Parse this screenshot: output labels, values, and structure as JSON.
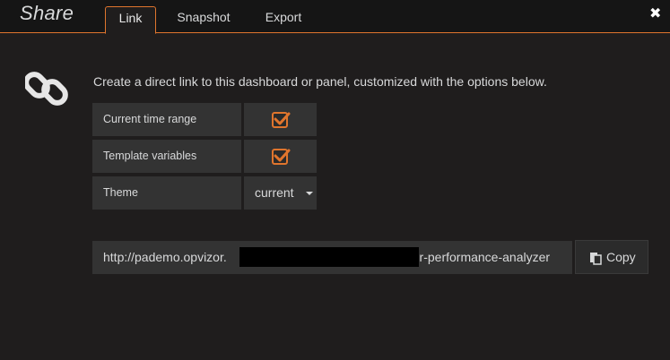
{
  "header": {
    "title": "Share",
    "tabs": [
      {
        "label": "Link",
        "active": true
      },
      {
        "label": "Snapshot",
        "active": false
      },
      {
        "label": "Export",
        "active": false
      }
    ],
    "close_glyph": "✖",
    "accent_color": "#e0752d"
  },
  "main": {
    "icon": "link-icon",
    "description": "Create a direct link to this dashboard or panel, customized with the options below.",
    "options": [
      {
        "label": "Current time range",
        "type": "checkbox",
        "checked": true
      },
      {
        "label": "Template variables",
        "type": "checkbox",
        "checked": true
      },
      {
        "label": "Theme",
        "type": "select",
        "value": "current"
      }
    ],
    "url": {
      "prefix": "http://pademo.opvizor.",
      "suffix": "zor-performance-analyzer"
    },
    "copy_button": {
      "label": "Copy",
      "icon": "clipboard-icon"
    }
  }
}
